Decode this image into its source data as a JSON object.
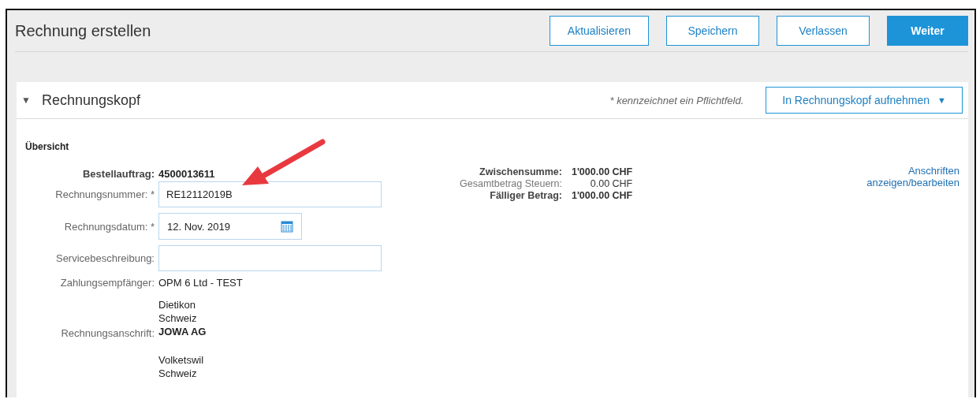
{
  "header": {
    "title": "Rechnung erstellen",
    "buttons": [
      {
        "label": "Aktualisieren",
        "primary": false
      },
      {
        "label": "Speichern",
        "primary": false
      },
      {
        "label": "Verlassen",
        "primary": false
      },
      {
        "label": "Weiter",
        "primary": true
      }
    ]
  },
  "section": {
    "title": "Rechnungskopf",
    "caret": "▼",
    "required_note_mark": "*",
    "required_note": "kennzeichnet ein Pflichtfeld.",
    "add_button": {
      "label": "In Rechnungskopf aufnehmen",
      "caret": "▼"
    }
  },
  "overview": {
    "title": "Übersicht",
    "fields": [
      {
        "kind": "text",
        "label": "Bestellauftrag:",
        "value": "4500013611",
        "bold": true
      },
      {
        "kind": "input",
        "label": "Rechnungsnummer:",
        "required_mark": "*",
        "value": "RE12112019B"
      },
      {
        "kind": "date",
        "label": "Rechnungsdatum:",
        "required_mark": "*",
        "value": "12. Nov. 2019"
      },
      {
        "kind": "input",
        "label": "Servicebeschreibung:"
      },
      {
        "kind": "text",
        "label": "Zahlungsempfänger:",
        "value": "OPM 6 Ltd - TEST",
        "bold": false
      },
      {
        "kind": "address",
        "label": "Rechnungsanschrift:",
        "before": [
          "Dietikon",
          "Schweiz"
        ],
        "name": "JOWA AG",
        "after": [
          "Volketswil",
          "Schweiz"
        ]
      }
    ],
    "totals": [
      {
        "label": "Zwischensumme:",
        "value": "1'000.00 CHF",
        "bold": true
      },
      {
        "label": "Gesamtbetrag Steuern:",
        "value": "0.00 CHF",
        "bold": false
      },
      {
        "label": "Fälliger Betrag:",
        "value": "1'000.00 CHF",
        "bold": true
      }
    ],
    "address_link": "Anschriften anzeigen/bearbeiten"
  }
}
